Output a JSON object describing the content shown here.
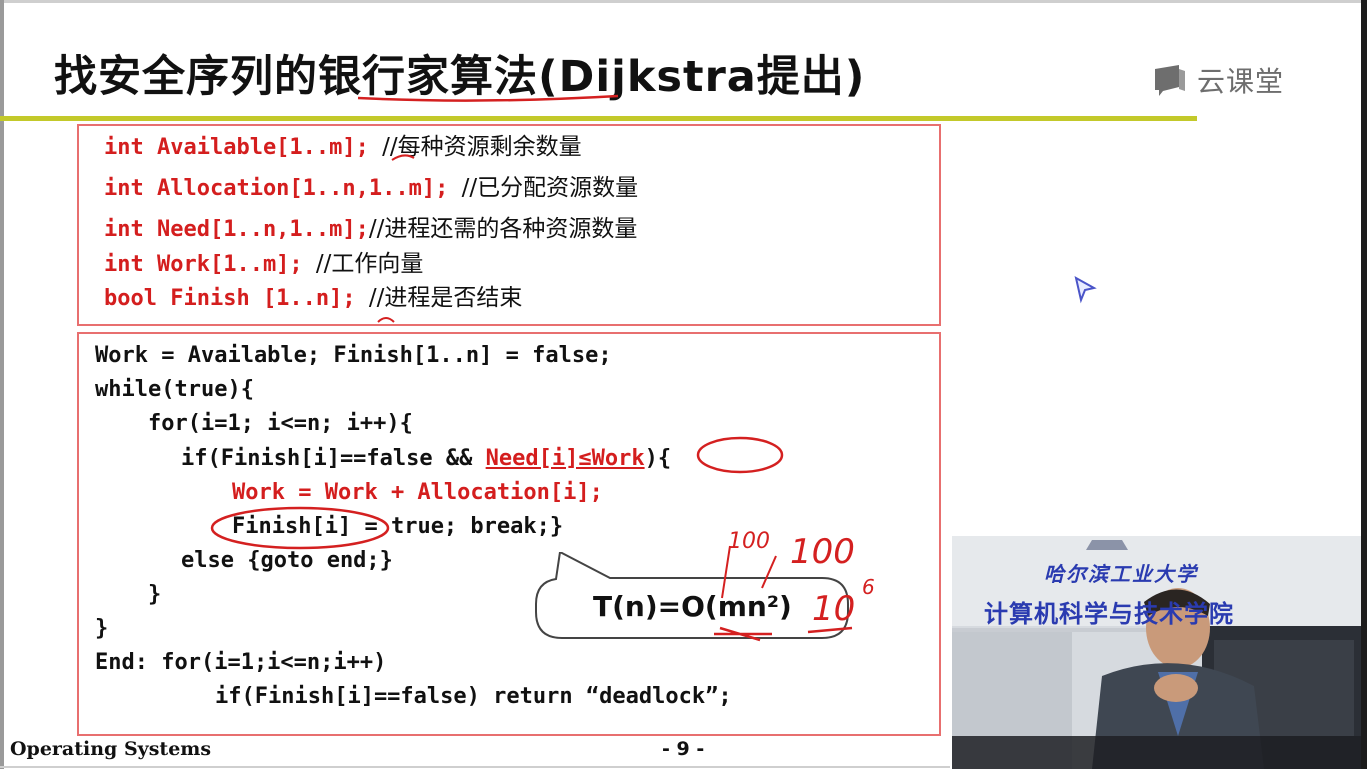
{
  "slide": {
    "title": "找安全序列的银行家算法(Dijkstra提出)",
    "logo_text": "云课堂",
    "declarations": [
      {
        "code": "int Available[1..m]; ",
        "comment": "//每种资源剩余数量"
      },
      {
        "code": "int Allocation[1..n,1..m]; ",
        "comment": "//已分配资源数量"
      },
      {
        "code": "int Need[1..n,1..m];",
        "comment": "//进程还需的各种资源数量"
      },
      {
        "code": "int Work[1..m]; ",
        "comment": "//工作向量"
      },
      {
        "code": "bool Finish [1..n]; ",
        "comment": "//进程是否结束"
      }
    ],
    "algorithm": {
      "line1": "Work = Available; Finish[1..n] = false;",
      "line2": "while(true){",
      "line3": "for(i=1; i<=n; i++){",
      "line4_a": "if(Finish[i]==false && ",
      "line4_b": "Need[i]≤Work",
      "line4_c": "){",
      "line5": "Work = Work + Allocation[i];",
      "line6_a": "Finish[i]",
      "line6_b": " = true; break;}",
      "line7": "else {goto end;}",
      "line8": "}",
      "line9": "}",
      "line10": "End: for(i=1;i<=n;i++)",
      "line11": "if(Finish[i]==false) return “deadlock”;"
    },
    "complexity": "T(n)=O(mn²)",
    "handwriting": {
      "a": "100",
      "b": "100",
      "c": "10",
      "c_exp": "6"
    },
    "footer_left": "Operating Systems",
    "page_number": "- 9 -"
  },
  "video": {
    "banner_line1": "哈尔滨工业大学",
    "banner_line2": "计算机科学与技术学院"
  }
}
